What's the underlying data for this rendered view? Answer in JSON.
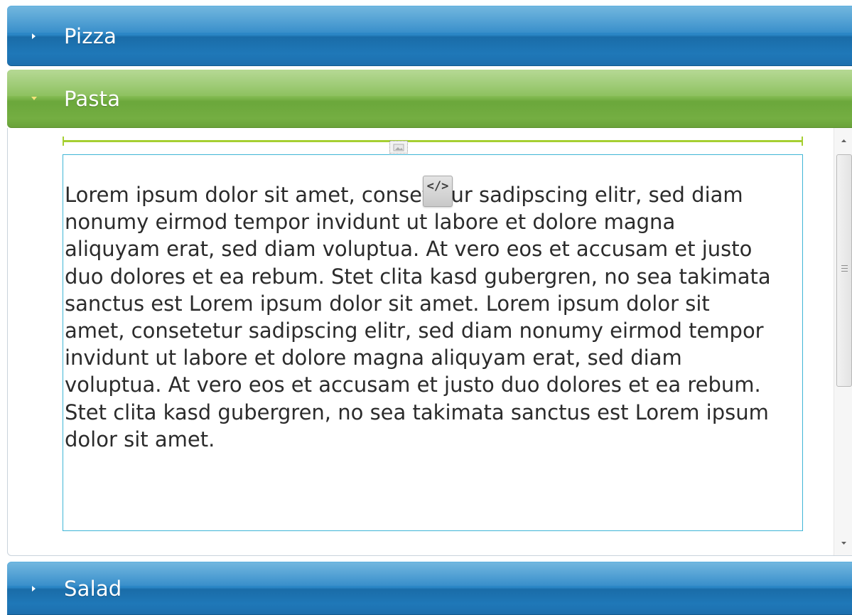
{
  "accordion": {
    "sections": [
      {
        "title": "Pizza",
        "expanded": false,
        "color": "#2b86c6"
      },
      {
        "title": "Pasta",
        "expanded": true,
        "color": "#7db64b"
      },
      {
        "title": "Salad",
        "expanded": false,
        "color": "#2b86c6"
      }
    ]
  },
  "pasta_content": {
    "text": "Lorem ipsum dolor sit amet, consetetur sadipscing elitr, sed diam nonumy eirmod tempor invidunt ut labore et dolore magna aliquyam erat, sed diam voluptua. At vero eos et accusam et justo duo dolores et ea rebum. Stet clita kasd gubergren, no sea takimata sanctus est Lorem ipsum dolor sit amet. Lorem ipsum dolor sit amet, consetetur sadipscing elitr, sed diam nonumy eirmod tempor invidunt ut labore et dolore magna aliquyam erat, sed diam voluptua. At vero eos et accusam et justo duo dolores et ea rebum. Stet clita kasd gubergren, no sea takimata sanctus est Lorem ipsum dolor sit amet.",
    "code_badge": "</>",
    "icons": [
      "image-placeholder-icon",
      "code-view-icon"
    ],
    "frame_color": "#3fb5d6",
    "ruler_color": "#a6cf32"
  }
}
